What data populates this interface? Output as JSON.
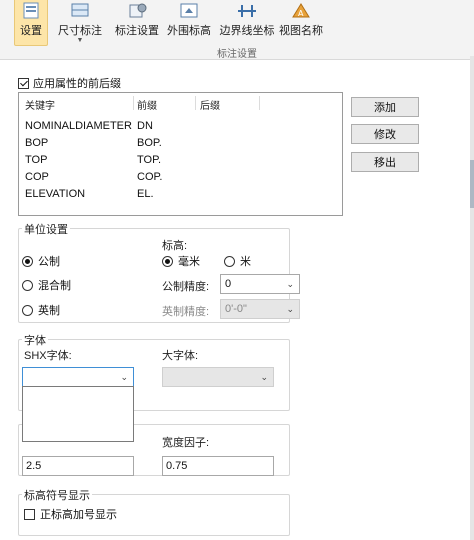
{
  "ribbon": {
    "buttons": [
      {
        "label": "设置",
        "icon": "settings-icon"
      },
      {
        "label": "尺寸标注",
        "icon": "dimension-icon"
      },
      {
        "label": "标注设置",
        "icon": "annotation-settings-icon"
      },
      {
        "label": "外围标高",
        "icon": "elevation-icon"
      },
      {
        "label": "边界线坐标",
        "icon": "boundary-coordinate-icon"
      },
      {
        "label": "视图名称",
        "icon": "view-name-icon"
      }
    ],
    "group_label": "标注设置"
  },
  "prefix": {
    "checkbox_label": "应用属性的前后缀",
    "checked": true,
    "columns": [
      "关键字",
      "前缀",
      "后缀"
    ],
    "rows": [
      {
        "key": "NOMINALDIAMETER",
        "prefix": "DN",
        "suffix": ""
      },
      {
        "key": "BOP",
        "prefix": "BOP.",
        "suffix": ""
      },
      {
        "key": "TOP",
        "prefix": "TOP.",
        "suffix": ""
      },
      {
        "key": "COP",
        "prefix": "COP.",
        "suffix": ""
      },
      {
        "key": "ELEVATION",
        "prefix": "EL.",
        "suffix": ""
      }
    ],
    "buttons": {
      "add": "添加",
      "edit": "修改",
      "remove": "移出"
    }
  },
  "units": {
    "title": "单位设置",
    "systems": [
      "公制",
      "混合制",
      "英制"
    ],
    "selected_system": "公制",
    "elevation_label": "标高:",
    "elevation_units": [
      "毫米",
      "米"
    ],
    "selected_elevation_unit": "毫米",
    "metric_precision_label": "公制精度:",
    "metric_precision_value": "0",
    "imperial_precision_label": "英制精度:",
    "imperial_precision_value": "0'-0\""
  },
  "font": {
    "title": "字体",
    "shx_label": "SHX字体:",
    "shx_value": "",
    "bigfont_label": "大字体:",
    "bigfont_value": "",
    "width_factor_label": "宽度因子:",
    "height_value": "2.5",
    "width_factor_value": "0.75"
  },
  "elevation_symbol": {
    "title": "标高符号显示",
    "checkbox_label": "正标高加号显示",
    "checked": false
  },
  "colors": {
    "accent": "#fde5a8",
    "focus_border": "#3f8fd6"
  }
}
